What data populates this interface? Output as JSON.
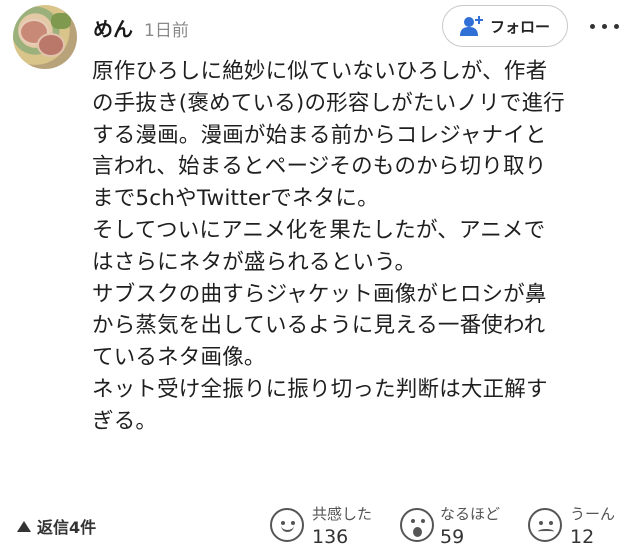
{
  "post": {
    "username": "めん",
    "timestamp": "1日前"
  },
  "header": {
    "follow_label": "フォロー",
    "follow_icon": "person-add-icon",
    "more_icon": "more-dots-icon"
  },
  "comment": {
    "lines": [
      "原作ひろしに絶妙に似ていないひろしが、作者",
      "の手抜き(褒めている)の形容しがたいノリで進行",
      "する漫画。漫画が始まる前からコレジャナイと",
      "言われ、始まるとページそのものから切り取り",
      "まで5chやTwitterでネタに。",
      "そしてついにアニメ化を果たしたが、アニメで",
      "はさらにネタが盛られるという。",
      "サブスクの曲すらジャケット画像がヒロシが鼻",
      "から蒸気を出しているように見える一番使われ",
      "ているネタ画像。",
      "ネット受け全振りに振り切った判断は大正解す",
      "ぎる。"
    ]
  },
  "footer": {
    "reply_label": "返信4件",
    "reactions": [
      {
        "label": "共感した",
        "count": "136",
        "icon": "smile-face-icon"
      },
      {
        "label": "なるほど",
        "count": "59",
        "icon": "surprised-face-icon"
      },
      {
        "label": "うーん",
        "count": "12",
        "icon": "confused-face-icon"
      }
    ]
  }
}
